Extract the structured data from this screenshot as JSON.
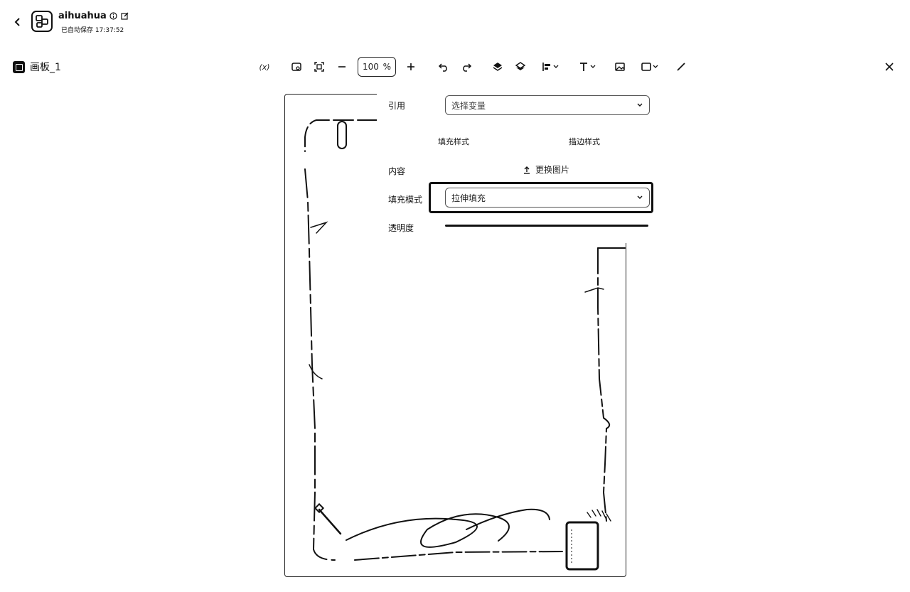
{
  "app": {
    "name": "aihuahua",
    "save_status": "已自动保存 17:37:52"
  },
  "canvas": {
    "title": "画板_1"
  },
  "toolbar": {
    "variable_label": "(x)",
    "zoom_value": "100",
    "zoom_unit": "%",
    "tools": [
      "variable",
      "fit-frame",
      "fit-screen",
      "zoom-out",
      "zoom-in",
      "undo",
      "redo",
      "layer-up",
      "layer-down",
      "align",
      "text",
      "image",
      "shape",
      "pen"
    ]
  },
  "panel": {
    "reference_label": "引用",
    "reference_placeholder": "选择变量",
    "fill_style_tab": "填充样式",
    "stroke_style_tab": "描边样式",
    "content_label": "内容",
    "replace_image_label": "更换图片",
    "fill_mode_label": "填充模式",
    "fill_mode_value": "拉伸填充",
    "opacity_label": "透明度"
  },
  "icons": {
    "back": "chevron-left-icon",
    "logo": "app-logo-icon",
    "info": "info-icon",
    "edit": "edit-icon",
    "close": "close-icon",
    "upload": "upload-icon",
    "dropdown": "chevron-down-icon"
  }
}
